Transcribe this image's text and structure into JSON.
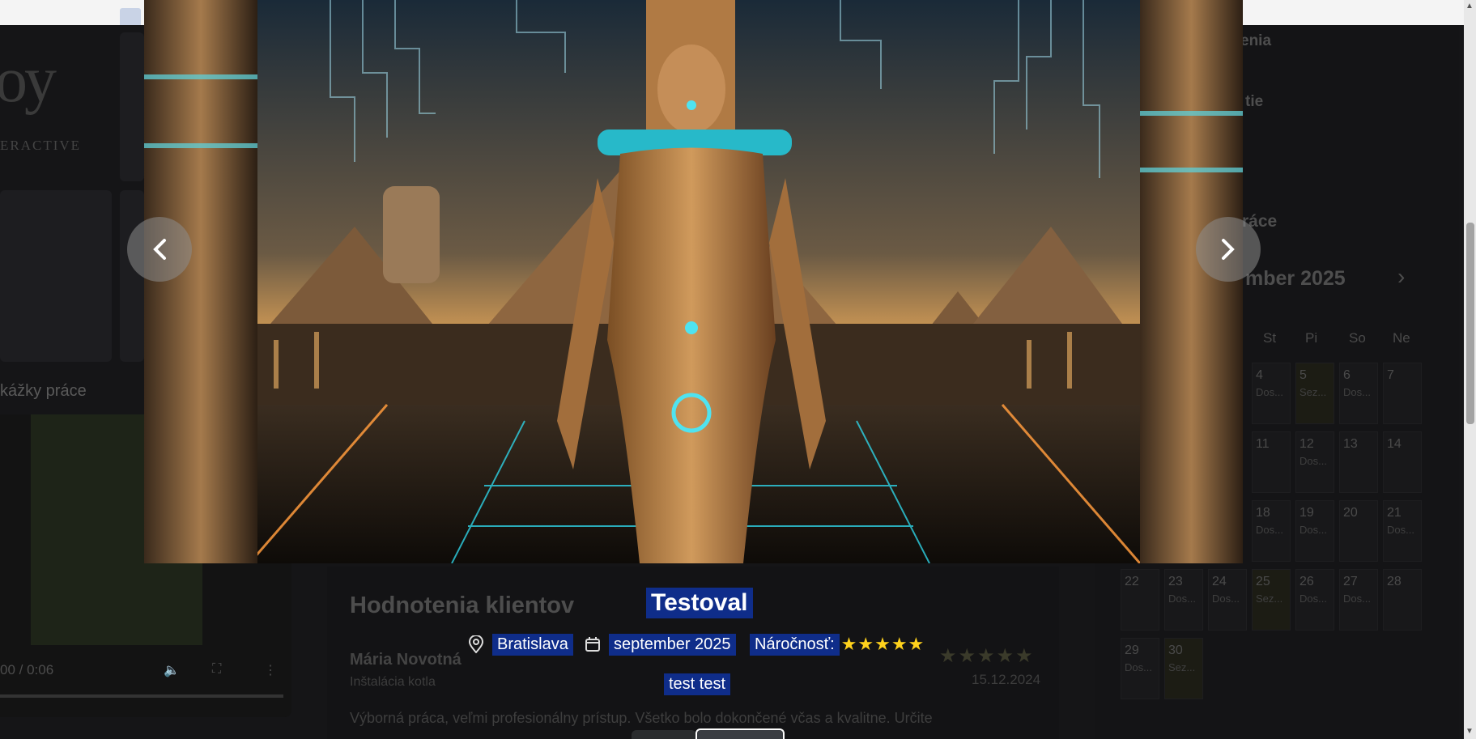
{
  "background": {
    "logo_text": "oy",
    "logo_sub": "ERACTIVE",
    "gallery_section_title": "kážky práce",
    "video_time": "00 / 0:06",
    "reviews": {
      "title": "Hodnotenia klientov",
      "reviewer_name": "Mária Novotná",
      "service": "Inštalácia kotla",
      "stars": "★★★★★",
      "date": "15.12.2024",
      "text": "Výborná práca, veľmi profesionálny prístup. Všetko bolo dokončené včas a kvalitne. Určite"
    },
    "right_panel": {
      "label_1": "enia",
      "label_2": "tie",
      "label_3": "ráce",
      "calendar_title": "mber 2025",
      "weekdays": [
        "St",
        "Pi",
        "So",
        "Ne"
      ],
      "days": [
        {
          "d": "4",
          "s": "Dos..."
        },
        {
          "d": "5",
          "s": "Sez..."
        },
        {
          "d": "6",
          "s": "Dos..."
        },
        {
          "d": "7",
          "s": ""
        },
        {
          "d": "11",
          "s": ""
        },
        {
          "d": "12",
          "s": "Dos..."
        },
        {
          "d": "13",
          "s": ""
        },
        {
          "d": "14",
          "s": ""
        },
        {
          "d": "18",
          "s": "Dos..."
        },
        {
          "d": "19",
          "s": "Dos..."
        },
        {
          "d": "20",
          "s": ""
        },
        {
          "d": "21",
          "s": "Dos..."
        },
        {
          "d": "22",
          "s": ""
        },
        {
          "d": "23",
          "s": "Dos..."
        },
        {
          "d": "24",
          "s": "Dos..."
        },
        {
          "d": "25",
          "s": "Sez..."
        },
        {
          "d": "26",
          "s": "Dos..."
        },
        {
          "d": "27",
          "s": "Dos..."
        },
        {
          "d": "28",
          "s": ""
        },
        {
          "d": "29",
          "s": "Dos..."
        },
        {
          "d": "30",
          "s": "Sez..."
        }
      ]
    }
  },
  "lightbox": {
    "title": "Testoval",
    "location": "Bratislava",
    "date": "september 2025",
    "difficulty_label": "Náročnosť:",
    "difficulty_stars": "★★★★★",
    "description": "test test",
    "prev_icon": "chevron-left-icon",
    "next_icon": "chevron-right-icon",
    "accent_highlight": "#0f2d8a",
    "star_color": "#ffd21c"
  }
}
